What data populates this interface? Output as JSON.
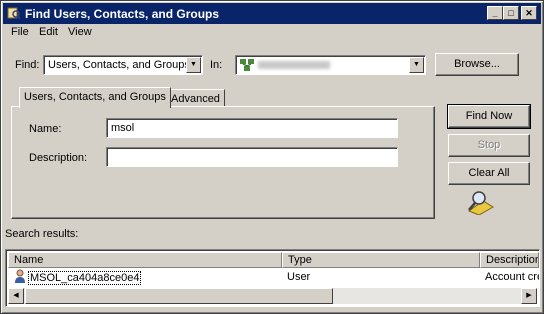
{
  "window": {
    "title": "Find Users, Contacts, and Groups"
  },
  "menu": {
    "file": "File",
    "edit": "Edit",
    "view": "View"
  },
  "find": {
    "label": "Find:",
    "selected": "Users, Contacts, and Groups",
    "in_label": "In:",
    "in_value": "",
    "browse": "Browse..."
  },
  "tabs": {
    "active": "Users, Contacts, and Groups",
    "inactive": "Advanced"
  },
  "form": {
    "name_label": "Name:",
    "name_value": "msol",
    "description_label": "Description:",
    "description_value": ""
  },
  "buttons": {
    "find_now": "Find Now",
    "stop": "Stop",
    "clear_all": "Clear All"
  },
  "results": {
    "label": "Search results:",
    "columns": [
      "Name",
      "Type",
      "Description"
    ],
    "rows": [
      {
        "name": "MSOL_ca404a8ce0e4",
        "type": "User",
        "description": "Account cre"
      }
    ]
  },
  "icons": [
    "app-icon",
    "minimize-icon",
    "maximize-icon",
    "close-icon",
    "dropdown-arrow-icon",
    "domain-icon",
    "search-magnifier-icon",
    "user-icon",
    "scroll-left-icon",
    "scroll-right-icon"
  ]
}
